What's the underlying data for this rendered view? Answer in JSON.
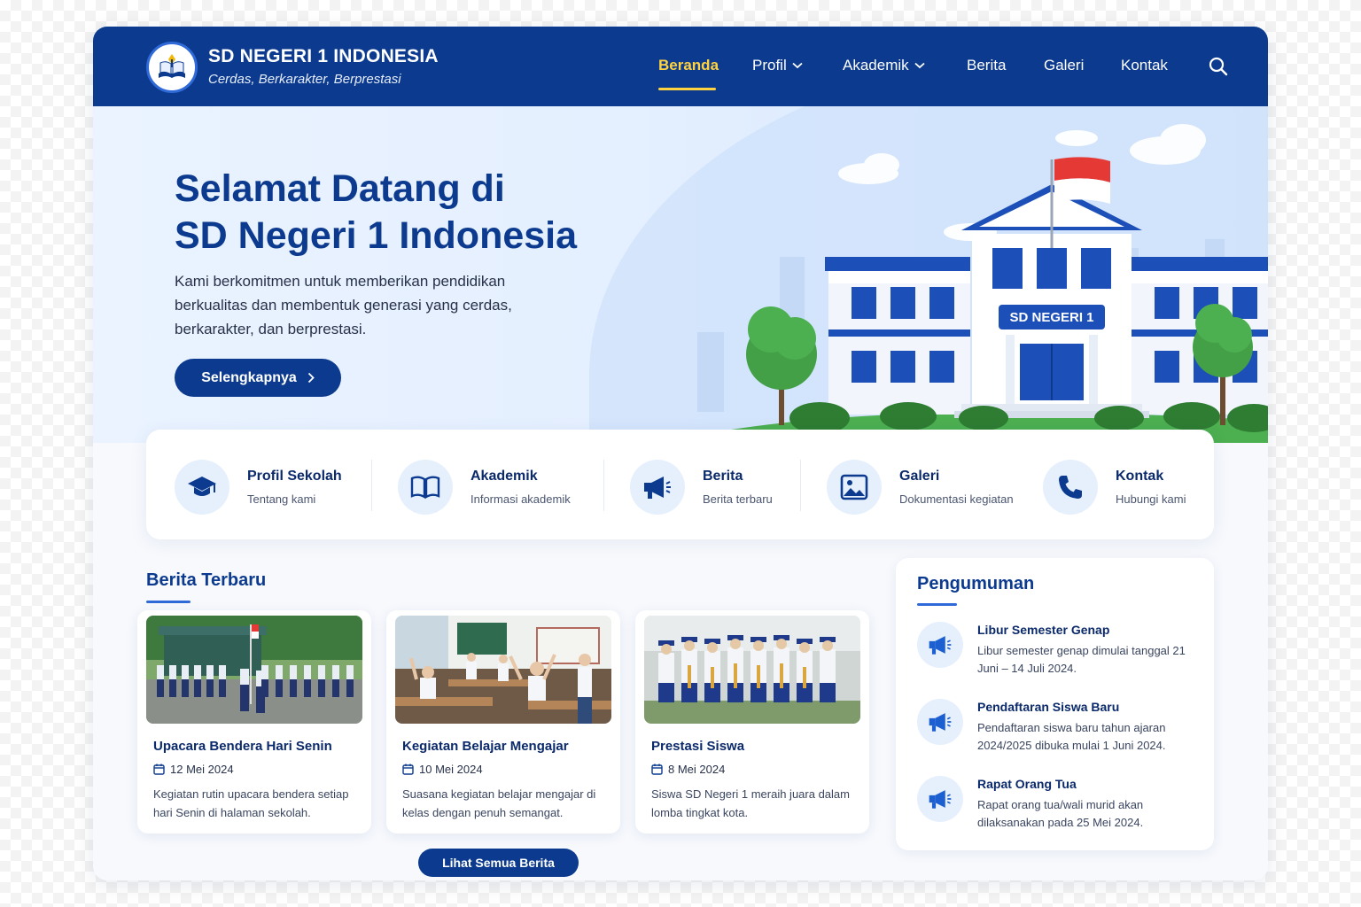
{
  "header": {
    "school_name": "SD NEGERI 1 INDONESIA",
    "tagline": "Cerdas, Berkarakter, Berprestasi",
    "nav": [
      {
        "label": "Beranda",
        "active": true,
        "has_dropdown": false
      },
      {
        "label": "Profil",
        "active": false,
        "has_dropdown": true
      },
      {
        "label": "Akademik",
        "active": false,
        "has_dropdown": true
      },
      {
        "label": "Berita",
        "active": false,
        "has_dropdown": false
      },
      {
        "label": "Galeri",
        "active": false,
        "has_dropdown": false
      },
      {
        "label": "Kontak",
        "active": false,
        "has_dropdown": false
      }
    ],
    "search_icon": "search-icon"
  },
  "hero": {
    "title_line1": "Selamat Datang di",
    "title_line2": "SD Negeri 1 Indonesia",
    "description": "Kami berkomitmen untuk memberikan pendidikan berkualitas dan membentuk generasi yang cerdas, berkarakter, dan berprestasi.",
    "button_label": "Selengkapnya",
    "building_sign": "SD NEGERI 1"
  },
  "quick_links": [
    {
      "title": "Profil Sekolah",
      "subtitle": "Tentang kami",
      "icon": "graduation-cap-icon"
    },
    {
      "title": "Akademik",
      "subtitle": "Informasi akademik",
      "icon": "book-icon"
    },
    {
      "title": "Berita",
      "subtitle": "Berita terbaru",
      "icon": "megaphone-icon"
    },
    {
      "title": "Galeri",
      "subtitle": "Dokumentasi kegiatan",
      "icon": "image-icon"
    },
    {
      "title": "Kontak",
      "subtitle": "Hubungi kami",
      "icon": "phone-icon"
    }
  ],
  "news": {
    "section_title": "Berita Terbaru",
    "items": [
      {
        "title": "Upacara Bendera Hari Senin",
        "date": "12 Mei 2024",
        "text": "Kegiatan rutin upacara bendera setiap hari Senin di halaman sekolah."
      },
      {
        "title": "Kegiatan Belajar Mengajar",
        "date": "10 Mei 2024",
        "text": "Suasana kegiatan belajar mengajar di kelas dengan penuh semangat."
      },
      {
        "title": "Prestasi Siswa",
        "date": "8 Mei 2024",
        "text": "Siswa SD Negeri 1 meraih juara dalam lomba tingkat kota."
      }
    ],
    "all_button": "Lihat Semua Berita"
  },
  "announcements": {
    "section_title": "Pengumuman",
    "items": [
      {
        "title": "Libur Semester Genap",
        "text": "Libur semester genap dimulai tanggal 21 Juni – 14 Juli 2024."
      },
      {
        "title": "Pendaftaran Siswa Baru",
        "text": "Pendaftaran siswa baru tahun ajaran 2024/2025 dibuka mulai 1 Juni 2024."
      },
      {
        "title": "Rapat Orang Tua",
        "text": "Rapat orang tua/wali murid akan dilaksanakan pada 25 Mei 2024."
      }
    ]
  },
  "colors": {
    "primary": "#0b3a8f",
    "accent": "#ffd23f",
    "flag_red": "#e53935"
  }
}
